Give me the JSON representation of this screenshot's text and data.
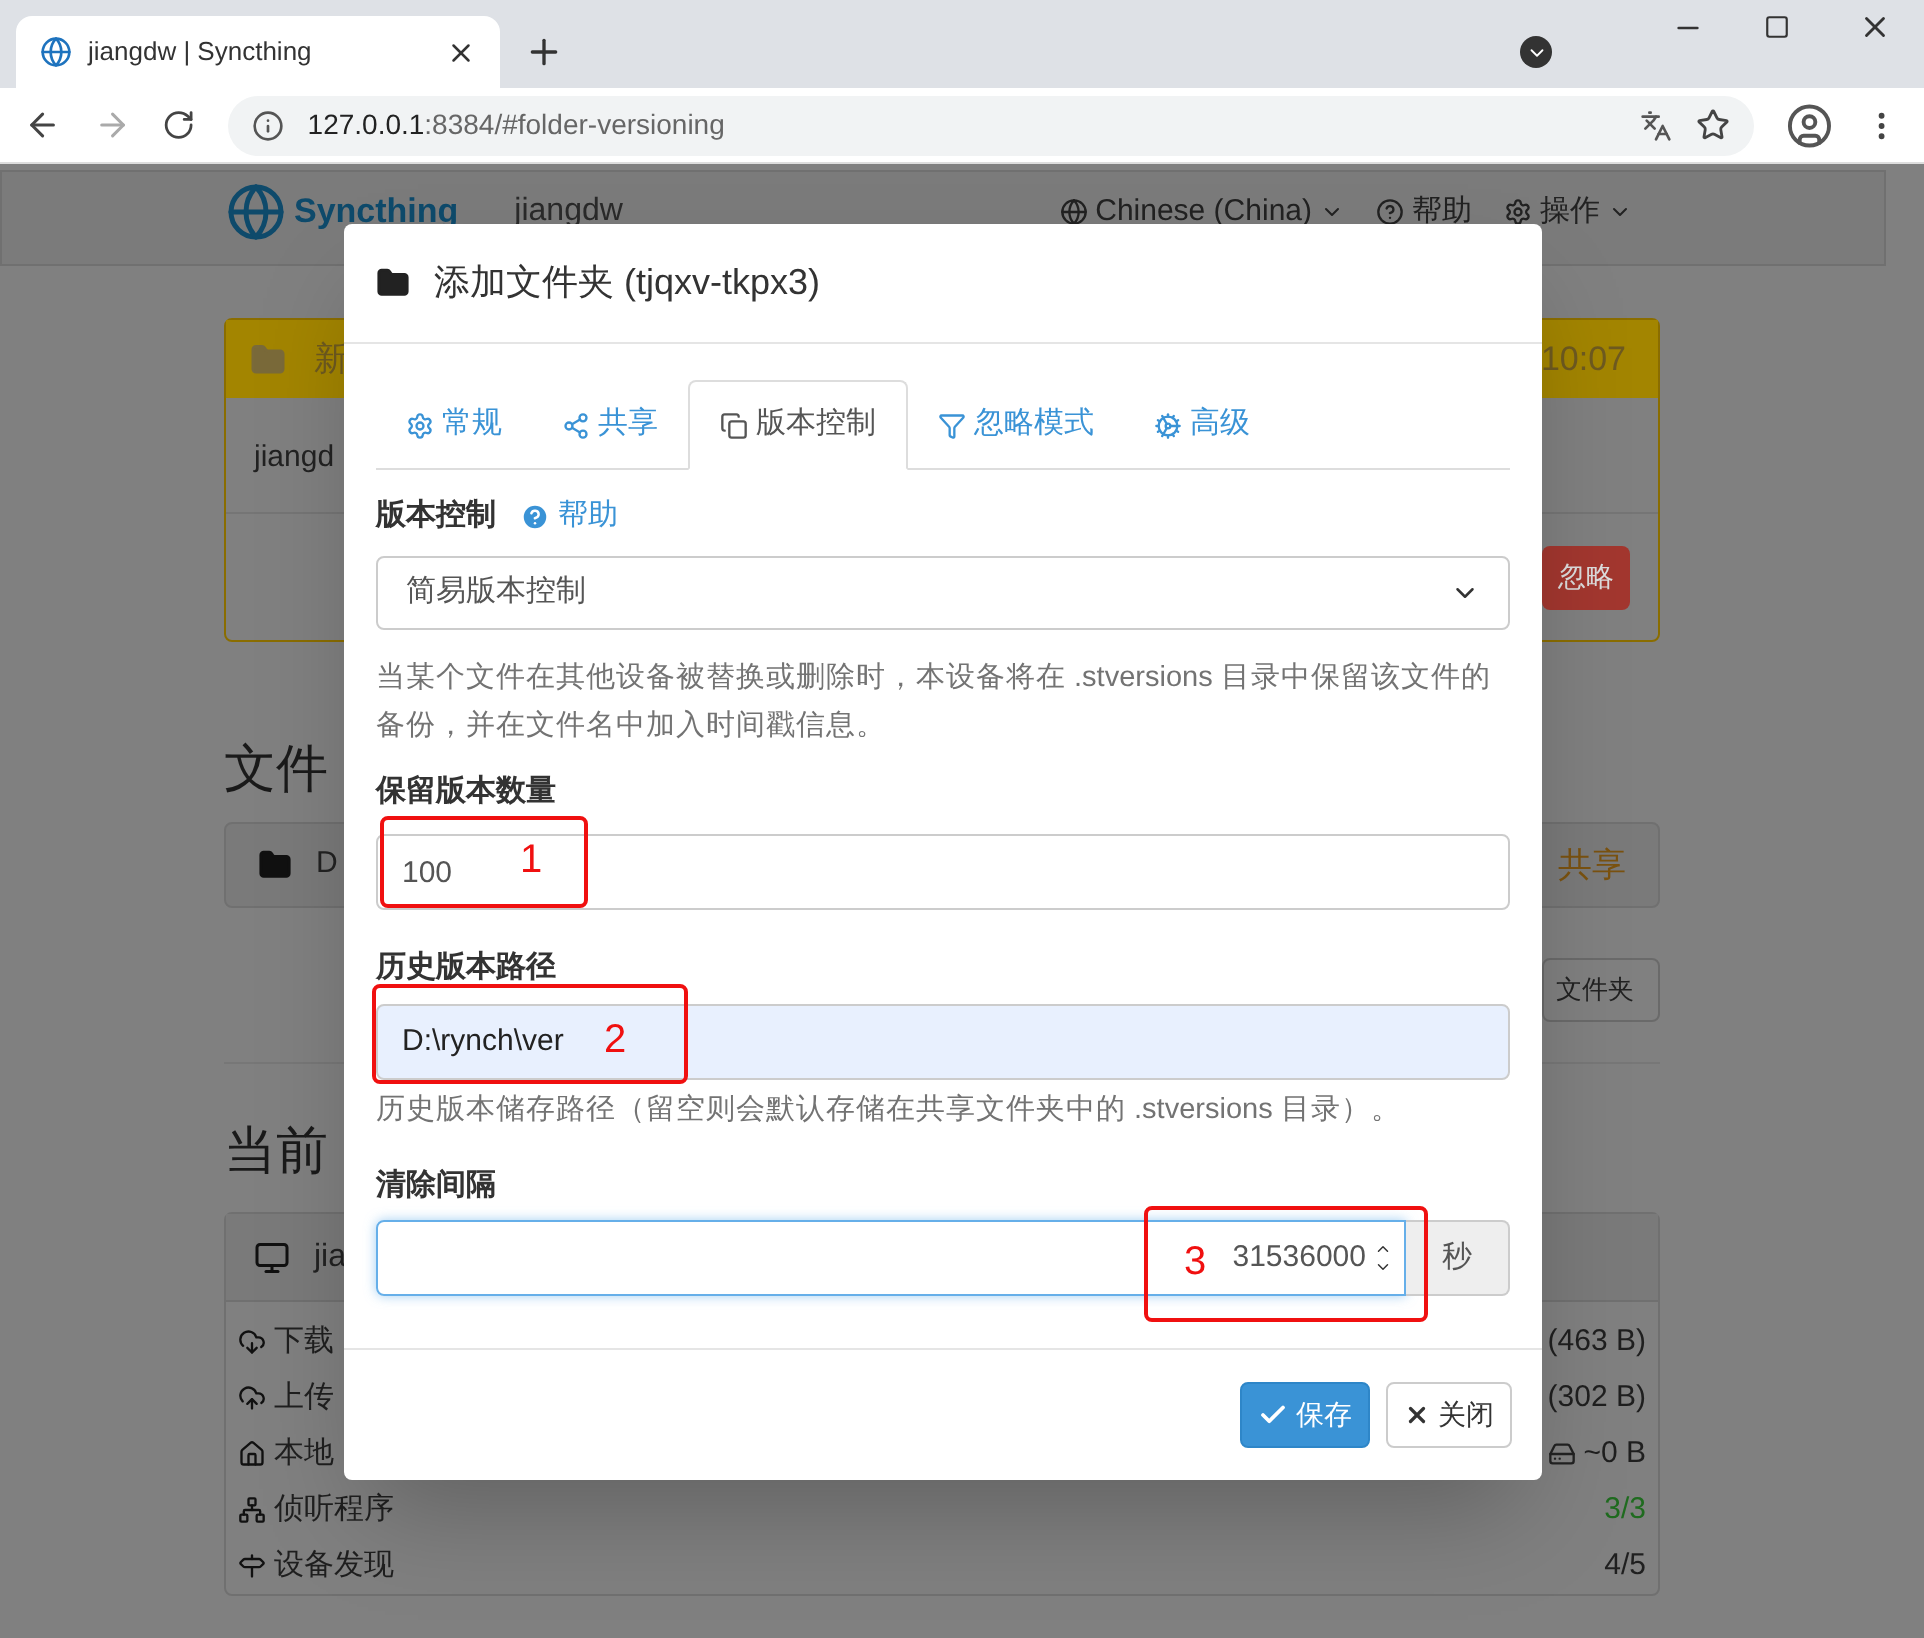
{
  "browser": {
    "tab_title": "jiangdw | Syncthing",
    "url_host": "127.0.0.1",
    "url_rest": ":8384/#folder-versioning"
  },
  "navbar": {
    "brand": "Syncthing",
    "device": "jiangdw",
    "language": "Chinese (China)",
    "help": "帮助",
    "actions": "操作"
  },
  "banner": {
    "title": "新",
    "time": "10:07",
    "device": "jiangd",
    "ignore_button": "忽略"
  },
  "folders": {
    "heading": "文件",
    "folder_name": "D",
    "status": "共享",
    "add_button": "文件夹"
  },
  "device": {
    "heading": "当前",
    "name": "jia",
    "stats": [
      {
        "kind": "download",
        "label": "下载",
        "value": "(463 B)",
        "ok": false
      },
      {
        "kind": "upload",
        "label": "上传",
        "value": "(302 B)",
        "ok": false
      },
      {
        "kind": "local",
        "label": "本地",
        "value": "~0 B",
        "ok": false
      },
      {
        "kind": "listeners",
        "label": "侦听程序",
        "value": "3/3",
        "ok": true
      },
      {
        "kind": "discovery",
        "label": "设备发现",
        "value": "4/5",
        "ok": false
      }
    ]
  },
  "modal": {
    "title": "添加文件夹 (tjqxv-tkpx3)",
    "tabs": [
      {
        "kind": "general",
        "label": "常规",
        "selected": false
      },
      {
        "kind": "sharing",
        "label": "共享",
        "selected": false
      },
      {
        "kind": "versioning",
        "label": "版本控制",
        "selected": true
      },
      {
        "kind": "ignore",
        "label": "忽略模式",
        "selected": false
      },
      {
        "kind": "advanced",
        "label": "高级",
        "selected": false
      }
    ],
    "versioning": {
      "label": "版本控制",
      "help": "帮助",
      "value": "简易版本控制",
      "description": "当某个文件在其他设备被替换或删除时，本设备将在 .stversions 目录中保留该文件的备份，并在文件名中加入时间戳信息。"
    },
    "keep": {
      "label": "保留版本数量",
      "value": "100"
    },
    "path": {
      "label": "历史版本路径",
      "value": "D:\\rynch\\ver",
      "autofilled": true,
      "help": "历史版本储存路径（留空则会默认存储在共享文件夹中的 .stversions 目录）。"
    },
    "cleanup": {
      "label": "清除间隔",
      "value": "31536000",
      "unit": "秒",
      "focused": true
    },
    "buttons": [
      {
        "kind": "primary",
        "label": "保存"
      },
      {
        "kind": "default",
        "label": "关闭"
      }
    ]
  },
  "annotations": [
    {
      "label": "1"
    },
    {
      "label": "2"
    },
    {
      "label": "3"
    }
  ]
}
